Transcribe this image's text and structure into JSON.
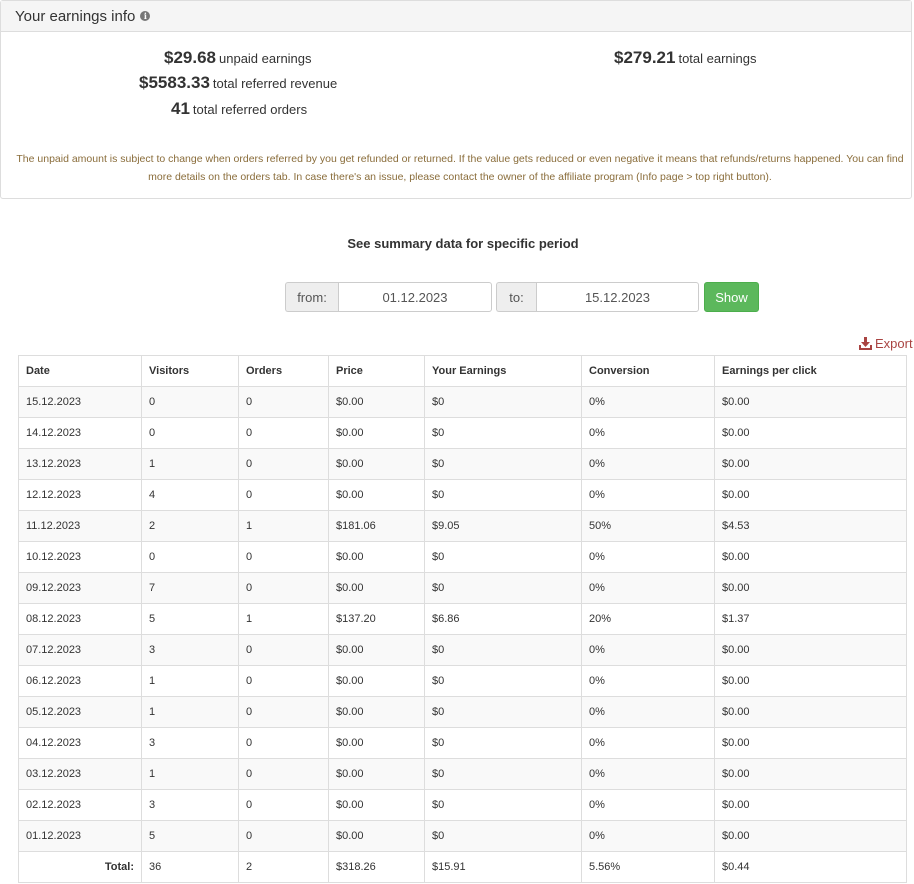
{
  "panel": {
    "title": "Your earnings info",
    "info_icon": "info-circle-icon",
    "stats": {
      "unpaid_value": "$29.68",
      "unpaid_label": "unpaid earnings",
      "revenue_value": "$5583.33",
      "revenue_label": "total referred revenue",
      "orders_value": "41",
      "orders_label": "total referred orders",
      "total_value": "$279.21",
      "total_label": "total earnings"
    },
    "notice": "The unpaid amount is subject to change when orders referred by you get refunded or returned. If the value gets reduced or even negative it means that refunds/returns happened. You can find more details on the orders tab. In case there's an issue, please contact the owner of the affiliate program (Info page > top right button)."
  },
  "summary": {
    "title": "See summary data for specific period",
    "from_label": "from:",
    "from_value": "01.12.2023",
    "to_label": "to:",
    "to_value": "15.12.2023",
    "show_label": "Show"
  },
  "export": {
    "label": "Export",
    "icon": "download-icon"
  },
  "colors": {
    "show_button": "#5cb85c",
    "export": "#a94442",
    "notice": "#8a6d3b"
  },
  "table": {
    "headers": [
      "Date",
      "Visitors",
      "Orders",
      "Price",
      "Your Earnings",
      "Conversion",
      "Earnings per click"
    ],
    "rows": [
      [
        "15.12.2023",
        "0",
        "0",
        "$0.00",
        "$0",
        "0%",
        "$0.00"
      ],
      [
        "14.12.2023",
        "0",
        "0",
        "$0.00",
        "$0",
        "0%",
        "$0.00"
      ],
      [
        "13.12.2023",
        "1",
        "0",
        "$0.00",
        "$0",
        "0%",
        "$0.00"
      ],
      [
        "12.12.2023",
        "4",
        "0",
        "$0.00",
        "$0",
        "0%",
        "$0.00"
      ],
      [
        "11.12.2023",
        "2",
        "1",
        "$181.06",
        "$9.05",
        "50%",
        "$4.53"
      ],
      [
        "10.12.2023",
        "0",
        "0",
        "$0.00",
        "$0",
        "0%",
        "$0.00"
      ],
      [
        "09.12.2023",
        "7",
        "0",
        "$0.00",
        "$0",
        "0%",
        "$0.00"
      ],
      [
        "08.12.2023",
        "5",
        "1",
        "$137.20",
        "$6.86",
        "20%",
        "$1.37"
      ],
      [
        "07.12.2023",
        "3",
        "0",
        "$0.00",
        "$0",
        "0%",
        "$0.00"
      ],
      [
        "06.12.2023",
        "1",
        "0",
        "$0.00",
        "$0",
        "0%",
        "$0.00"
      ],
      [
        "05.12.2023",
        "1",
        "0",
        "$0.00",
        "$0",
        "0%",
        "$0.00"
      ],
      [
        "04.12.2023",
        "3",
        "0",
        "$0.00",
        "$0",
        "0%",
        "$0.00"
      ],
      [
        "03.12.2023",
        "1",
        "0",
        "$0.00",
        "$0",
        "0%",
        "$0.00"
      ],
      [
        "02.12.2023",
        "3",
        "0",
        "$0.00",
        "$0",
        "0%",
        "$0.00"
      ],
      [
        "01.12.2023",
        "5",
        "0",
        "$0.00",
        "$0",
        "0%",
        "$0.00"
      ]
    ],
    "total": [
      "Total:",
      "36",
      "2",
      "$318.26",
      "$15.91",
      "5.56%",
      "$0.44"
    ]
  }
}
